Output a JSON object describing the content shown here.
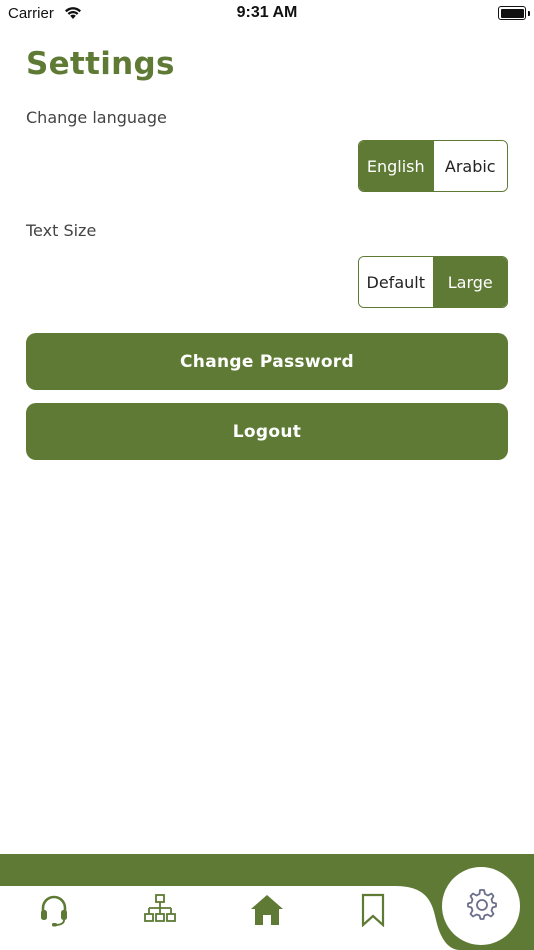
{
  "status_bar": {
    "carrier": "Carrier",
    "time": "9:31 AM"
  },
  "page": {
    "title": "Settings"
  },
  "language": {
    "label": "Change language",
    "options": [
      "English",
      "Arabic"
    ],
    "selected": "English"
  },
  "text_size": {
    "label": "Text Size",
    "options": [
      "Default",
      "Large"
    ],
    "selected": "Large"
  },
  "buttons": {
    "change_password": "Change Password",
    "logout": "Logout"
  },
  "tab_bar": {
    "items": [
      {
        "icon": "headset-icon"
      },
      {
        "icon": "org-chart-icon"
      },
      {
        "icon": "home-icon"
      },
      {
        "icon": "bookmark-icon"
      },
      {
        "icon": "gear-icon",
        "active": true
      }
    ]
  },
  "colors": {
    "accent": "#5e7a35",
    "background": "#ffffff",
    "inactive_icon": "#5e7a35",
    "active_icon": "#6b6f8a"
  }
}
